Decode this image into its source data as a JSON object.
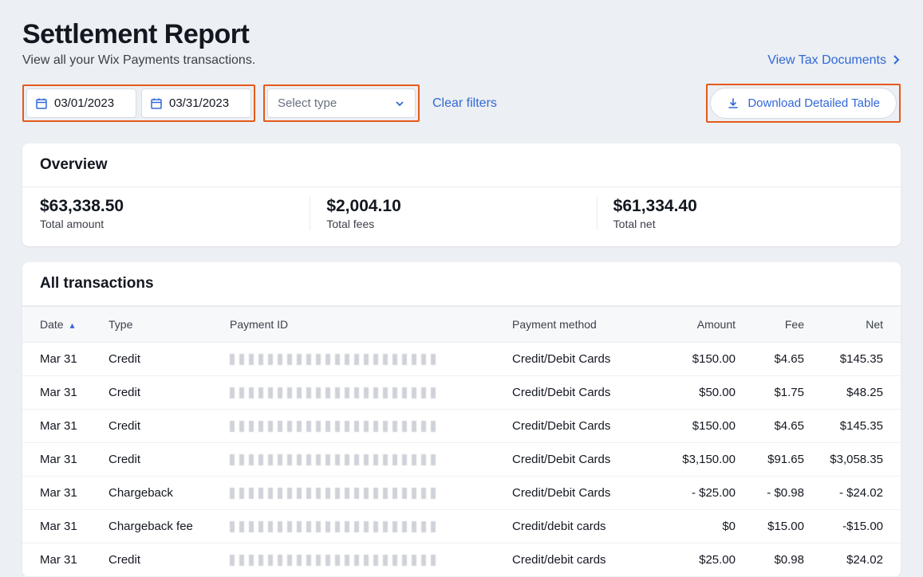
{
  "header": {
    "title": "Settlement Report",
    "subtitle": "View all your Wix Payments transactions.",
    "tax_link": "View Tax Documents"
  },
  "filters": {
    "date_from": "03/01/2023",
    "date_to": "03/31/2023",
    "type_placeholder": "Select type",
    "clear_label": "Clear filters",
    "download_label": "Download Detailed Table"
  },
  "overview": {
    "title": "Overview",
    "cells": [
      {
        "value": "$63,338.50",
        "label": "Total amount"
      },
      {
        "value": "$2,004.10",
        "label": "Total fees"
      },
      {
        "value": "$61,334.40",
        "label": "Total net"
      }
    ]
  },
  "transactions": {
    "title": "All transactions",
    "columns": {
      "date": "Date",
      "type": "Type",
      "payment_id": "Payment ID",
      "method": "Payment method",
      "amount": "Amount",
      "fee": "Fee",
      "net": "Net"
    },
    "rows": [
      {
        "date": "Mar 31",
        "type": "Credit",
        "method": "Credit/Debit Cards",
        "amount": "$150.00",
        "fee": "$4.65",
        "net": "$145.35"
      },
      {
        "date": "Mar 31",
        "type": "Credit",
        "method": "Credit/Debit Cards",
        "amount": "$50.00",
        "fee": "$1.75",
        "net": "$48.25"
      },
      {
        "date": "Mar 31",
        "type": "Credit",
        "method": "Credit/Debit Cards",
        "amount": "$150.00",
        "fee": "$4.65",
        "net": "$145.35"
      },
      {
        "date": "Mar 31",
        "type": "Credit",
        "method": "Credit/Debit Cards",
        "amount": "$3,150.00",
        "fee": "$91.65",
        "net": "$3,058.35"
      },
      {
        "date": "Mar 31",
        "type": "Chargeback",
        "method": "Credit/Debit Cards",
        "amount": "- $25.00",
        "fee": "- $0.98",
        "net": "- $24.02"
      },
      {
        "date": "Mar 31",
        "type": "Chargeback fee",
        "method": "Credit/debit cards",
        "amount": "$0",
        "fee": "$15.00",
        "net": "-$15.00"
      },
      {
        "date": "Mar 31",
        "type": "Credit",
        "method": "Credit/debit cards",
        "amount": "$25.00",
        "fee": "$0.98",
        "net": "$24.02"
      }
    ]
  }
}
